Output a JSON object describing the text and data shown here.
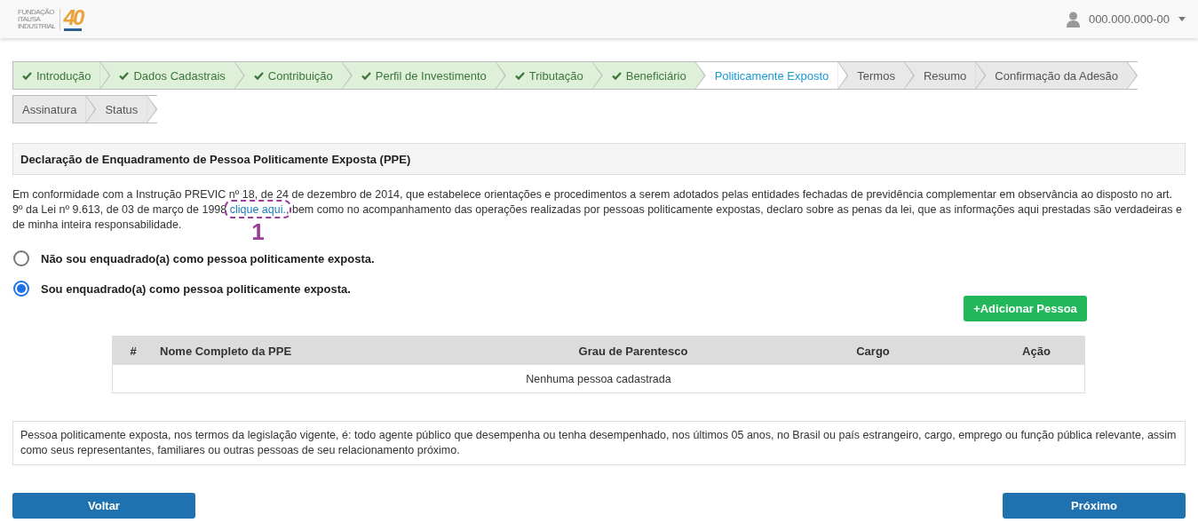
{
  "header": {
    "logo": {
      "lines": [
        "FUNDAÇÃO",
        "ITAUSA",
        "INDUSTRIAL"
      ],
      "mark": "40"
    },
    "user": {
      "label": "000.000.000-00"
    }
  },
  "steps": [
    {
      "label": "Introdução",
      "done": true,
      "selected": false
    },
    {
      "label": "Dados Cadastrais",
      "done": true,
      "selected": false
    },
    {
      "label": "Contribuição",
      "done": true,
      "selected": false
    },
    {
      "label": "Perfil de Investimento",
      "done": true,
      "selected": false
    },
    {
      "label": "Tributação",
      "done": true,
      "selected": false
    },
    {
      "label": "Beneficiário",
      "done": true,
      "selected": false
    },
    {
      "label": "Politicamente Exposto",
      "done": false,
      "selected": true
    },
    {
      "label": "Termos",
      "done": false,
      "selected": false
    },
    {
      "label": "Resumo",
      "done": false,
      "selected": false
    },
    {
      "label": "Confirmação da Adesão",
      "done": false,
      "selected": false
    },
    {
      "label": "Assinatura",
      "done": false,
      "selected": false
    },
    {
      "label": "Status",
      "done": false,
      "selected": false
    }
  ],
  "section": {
    "title": "Declaração de Enquadramento de Pessoa Politicamente Exposta (PPE)",
    "paragraph_before": "Em conformidade com a Instrução PREVIC nº 18, de 24 de dezembro de 2014, que estabelece orientações e procedimentos a serem adotados pelas entidades fechadas de previdência complementar em observância ao disposto no art. 9º da Lei nº 9.613, de 03 de março de 1998",
    "link": "clique aqui.",
    "paragraph_after": ", bem como no acompanhamento das operações realizadas por pessoas politicamente expostas, declaro sobre as penas da lei, que as informações aqui prestadas são verdadeiras e de minha inteira responsabilidade.",
    "annotation": {
      "label": "1"
    }
  },
  "options": [
    {
      "label": "Não sou enquadrado(a) como pessoa politicamente exposta.",
      "selected": false
    },
    {
      "label": "Sou enquadrado(a) como pessoa politicamente exposta.",
      "selected": true
    }
  ],
  "add_button": {
    "icon": "+",
    "label": "Adicionar Pessoa"
  },
  "table": {
    "columns": [
      "#",
      "Nome Completo da PPE",
      "Grau de Parentesco",
      "Cargo",
      "Ação"
    ],
    "empty_message": "Nenhuma pessoa cadastrada"
  },
  "note": "Pessoa politicamente exposta, nos termos da legislação vigente, é: todo agente público que desempenha ou tenha desempenhado, nos últimos 05 anos, no Brasil ou país estrangeiro, cargo, emprego ou função pública relevante, assim como seus representantes, familiares ou outras pessoas de seu relacionamento próximo.",
  "buttons": {
    "back": "Voltar",
    "next": "Próximo"
  }
}
